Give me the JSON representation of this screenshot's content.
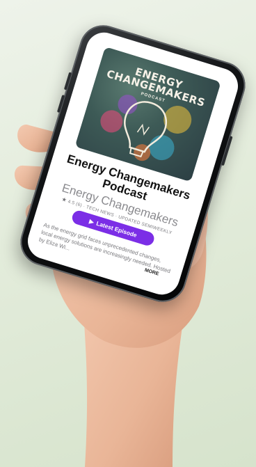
{
  "cover": {
    "title_line1": "ENERGY",
    "title_line2": "CHANGEMAKERS",
    "subtitle": "PODCAST"
  },
  "podcast": {
    "title_line1": "Energy Changemakers",
    "title_line2": "Podcast",
    "author": "Energy Changemakers",
    "rating": "4.5 (6)",
    "category": "TECH NEWS",
    "update_schedule": "UPDATED SEMIWEEKLY",
    "description": "As the energy grid faces unprecedented changes, local energy solutions are increasingly needed. Hosted by Eliza Wi..."
  },
  "actions": {
    "latest_episode": "Latest Episode",
    "more": "MORE"
  },
  "icons": {
    "star": "star-icon",
    "play": "play-icon"
  },
  "colors": {
    "accent": "#7b2ee6",
    "background": "#e3ecdb"
  }
}
